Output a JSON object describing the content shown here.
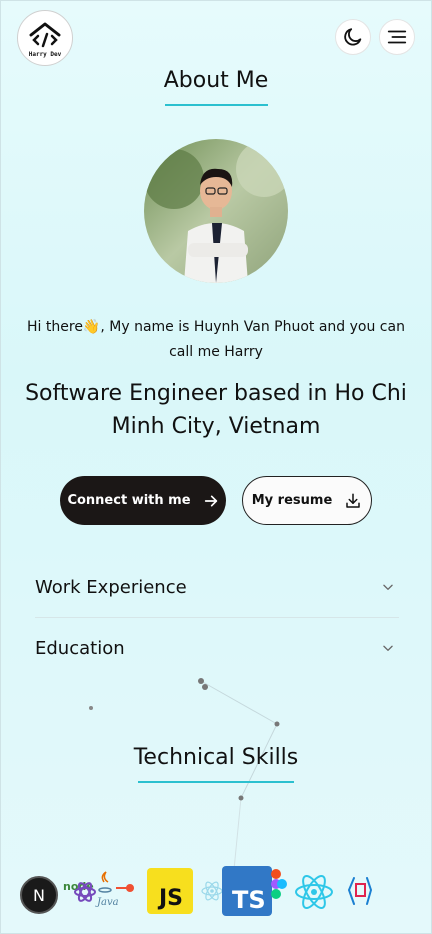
{
  "header": {
    "logo_text": "Harry Dev",
    "logo_icon": "code-house-logo",
    "theme_icon": "moon-icon",
    "menu_icon": "menu-icon"
  },
  "about": {
    "title": "About Me",
    "intro": "Hi there👋, My name is Huynh Van Phuot and you can call me Harry",
    "headline": "Software Engineer based in Ho Chi Minh City, Vietnam"
  },
  "actions": {
    "connect_label": "Connect with me",
    "connect_icon": "arrow-right-icon",
    "resume_label": "My resume",
    "resume_icon": "download-icon"
  },
  "accordion": {
    "items": [
      {
        "label": "Work Experience",
        "icon": "chevron-down-icon"
      },
      {
        "label": "Education",
        "icon": "chevron-down-icon"
      }
    ]
  },
  "skills": {
    "title": "Technical Skills",
    "logos": [
      "nodejs",
      "redux",
      "java",
      "git",
      "javascript",
      "react",
      "typescript",
      "figma",
      "react-native",
      "nestjs"
    ],
    "js_label": "JS",
    "ts_label": "TS",
    "java_label": "Java"
  },
  "next_badge": "N",
  "colors": {
    "accent": "#2bc0cf",
    "dark_button": "#1b1716",
    "js_yellow": "#f7df1e",
    "ts_blue": "#3178c6",
    "react_blue": "#2ec7e8"
  }
}
